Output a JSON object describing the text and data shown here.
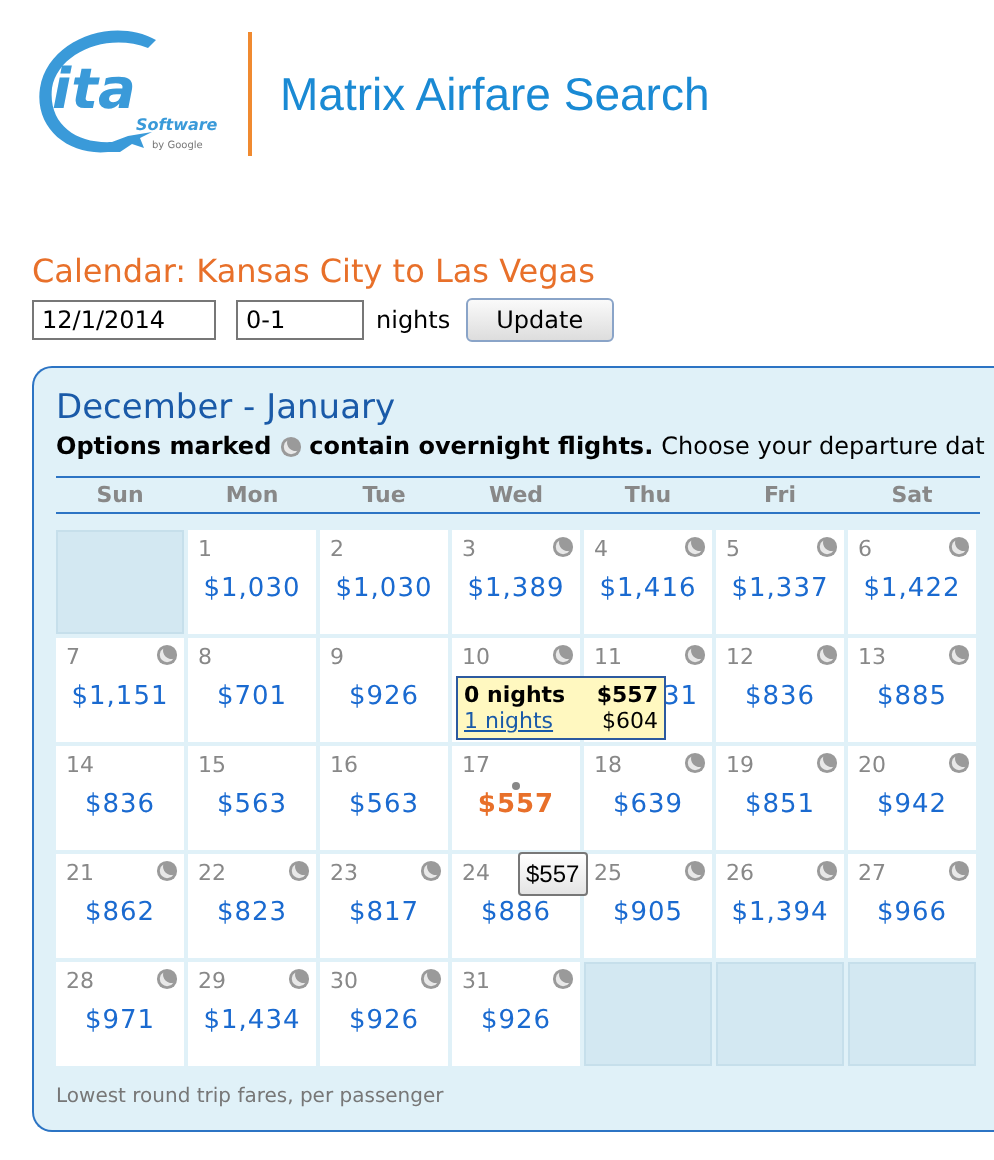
{
  "logo": {
    "word": "ita",
    "sub": "Software",
    "by": "by Google"
  },
  "title": "Matrix Airfare Search",
  "heading": "Calendar: Kansas City to Las Vegas",
  "form": {
    "date": "12/1/2014",
    "nights": "0-1",
    "nights_label": "nights",
    "button": "Update"
  },
  "panel": {
    "title": "December - January",
    "note_bold_1": "Options marked",
    "note_bold_2": "contain overnight flights.",
    "note_rest": "Choose your departure dat",
    "weekdays": [
      "Sun",
      "Mon",
      "Tue",
      "Wed",
      "Thu",
      "Fri",
      "Sat"
    ],
    "weeks": [
      [
        {
          "kind": "blank"
        },
        {
          "kind": "day",
          "day": "1",
          "price": "$1,030",
          "overnight": false,
          "selected": false
        },
        {
          "kind": "day",
          "day": "2",
          "price": "$1,030",
          "overnight": false,
          "selected": false
        },
        {
          "kind": "day",
          "day": "3",
          "price": "$1,389",
          "overnight": true,
          "selected": false
        },
        {
          "kind": "day",
          "day": "4",
          "price": "$1,416",
          "overnight": true,
          "selected": false
        },
        {
          "kind": "day",
          "day": "5",
          "price": "$1,337",
          "overnight": true,
          "selected": false
        },
        {
          "kind": "day",
          "day": "6",
          "price": "$1,422",
          "overnight": true,
          "selected": false
        }
      ],
      [
        {
          "kind": "day",
          "day": "7",
          "price": "$1,151",
          "overnight": true,
          "selected": false
        },
        {
          "kind": "day",
          "day": "8",
          "price": "$701",
          "overnight": false,
          "selected": false
        },
        {
          "kind": "day",
          "day": "9",
          "price": "$926",
          "overnight": false,
          "selected": false
        },
        {
          "kind": "day",
          "day": "10",
          "overnight": true,
          "selected": false,
          "popup": [
            {
              "kind": "current",
              "label": "0 nights",
              "price": "$557"
            },
            {
              "kind": "link",
              "label": "1 nights",
              "price": "$604"
            }
          ]
        },
        {
          "kind": "day",
          "day": "11",
          "price": "31",
          "covered": true,
          "overnight": true,
          "selected": false
        },
        {
          "kind": "day",
          "day": "12",
          "price": "$836",
          "overnight": true,
          "selected": false
        },
        {
          "kind": "day",
          "day": "13",
          "price": "$885",
          "overnight": true,
          "selected": false
        }
      ],
      [
        {
          "kind": "day",
          "day": "14",
          "price": "$836",
          "overnight": false,
          "selected": false
        },
        {
          "kind": "day",
          "day": "15",
          "price": "$563",
          "overnight": false,
          "selected": false
        },
        {
          "kind": "day",
          "day": "16",
          "price": "$563",
          "overnight": false,
          "selected": false
        },
        {
          "kind": "day",
          "day": "17",
          "price": "$557",
          "overnight": false,
          "selected": true
        },
        {
          "kind": "day",
          "day": "18",
          "price": "$639",
          "overnight": true,
          "selected": false
        },
        {
          "kind": "day",
          "day": "19",
          "price": "$851",
          "overnight": true,
          "selected": false
        },
        {
          "kind": "day",
          "day": "20",
          "price": "$942",
          "overnight": true,
          "selected": false
        }
      ],
      [
        {
          "kind": "day",
          "day": "21",
          "price": "$862",
          "overnight": true,
          "selected": false
        },
        {
          "kind": "day",
          "day": "22",
          "price": "$823",
          "overnight": true,
          "selected": false
        },
        {
          "kind": "day",
          "day": "23",
          "price": "$817",
          "overnight": true,
          "selected": false
        },
        {
          "kind": "day",
          "day": "24",
          "price": "$886",
          "selected": false,
          "hover_tip": "$557"
        },
        {
          "kind": "day",
          "day": "25",
          "price": "$905",
          "overnight": true,
          "selected": false
        },
        {
          "kind": "day",
          "day": "26",
          "price": "$1,394",
          "overnight": true,
          "selected": false
        },
        {
          "kind": "day",
          "day": "27",
          "price": "$966",
          "overnight": true,
          "selected": false
        }
      ],
      [
        {
          "kind": "day",
          "day": "28",
          "price": "$971",
          "overnight": true,
          "selected": false
        },
        {
          "kind": "day",
          "day": "29",
          "price": "$1,434",
          "overnight": true,
          "selected": false
        },
        {
          "kind": "day",
          "day": "30",
          "price": "$926",
          "overnight": true,
          "selected": false
        },
        {
          "kind": "day",
          "day": "31",
          "price": "$926",
          "overnight": true,
          "selected": false
        },
        {
          "kind": "blank"
        },
        {
          "kind": "blank"
        },
        {
          "kind": "blank"
        }
      ]
    ],
    "footer": "Lowest round trip fares, per passenger"
  }
}
